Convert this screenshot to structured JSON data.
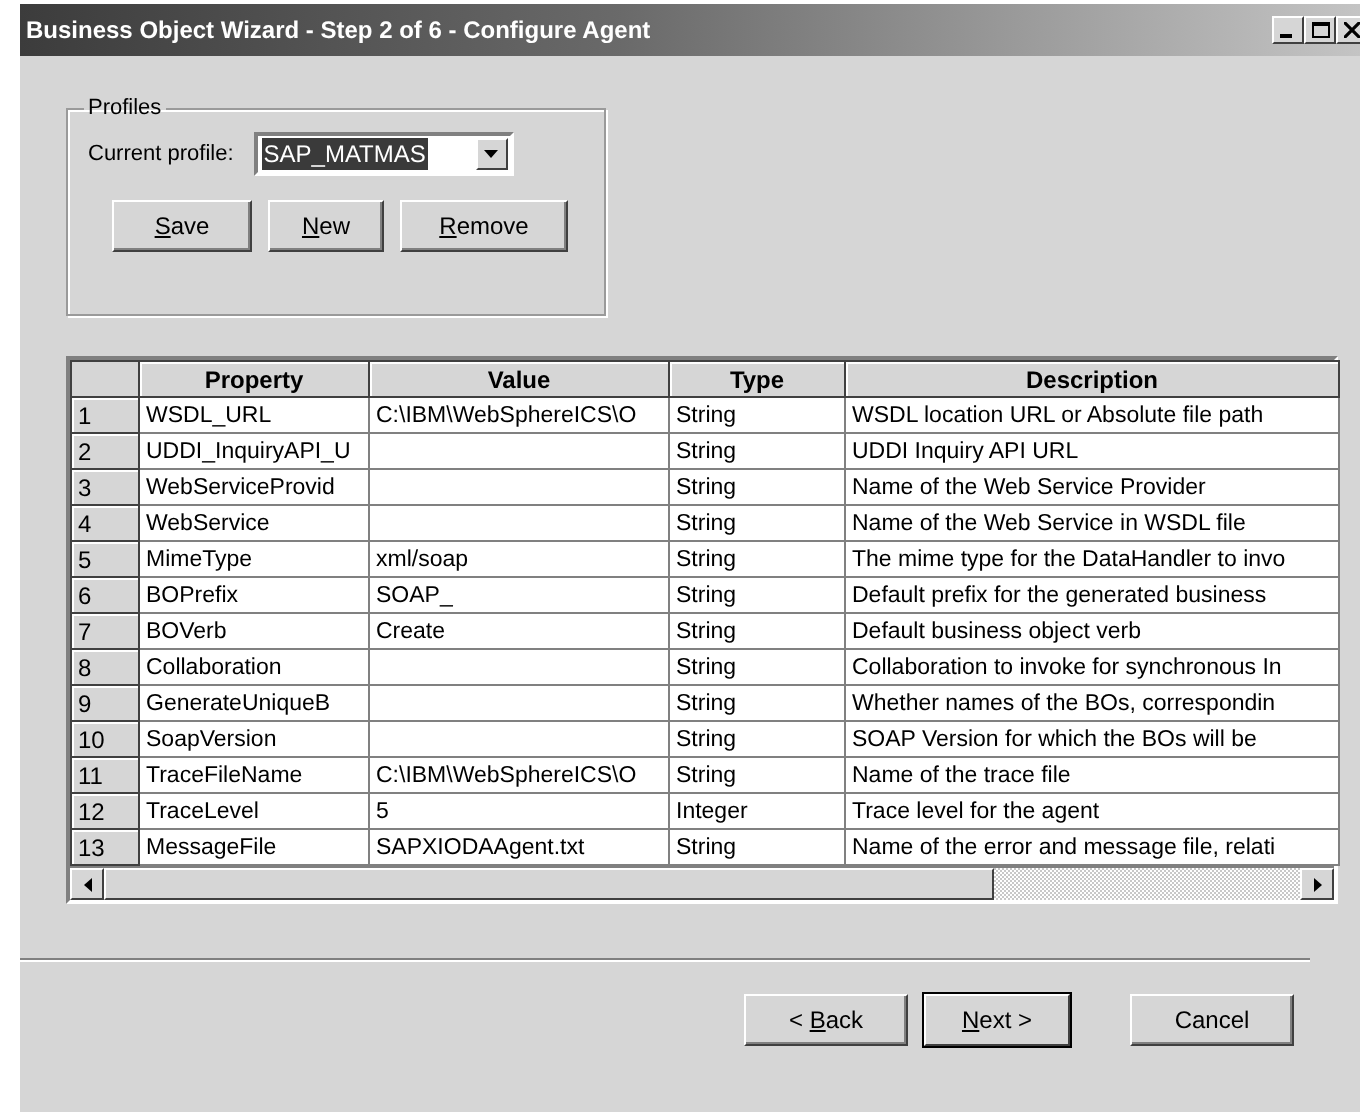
{
  "window": {
    "title": "Business Object Wizard - Step 2 of 6 - Configure Agent"
  },
  "profiles": {
    "legend": "Profiles",
    "label": "Current profile:",
    "value": "SAP_MATMAS",
    "text_selected": true,
    "buttons": [
      {
        "key": "S",
        "post": "ave"
      },
      {
        "key": "N",
        "post": "ew"
      },
      {
        "key": "R",
        "post": "emove"
      }
    ]
  },
  "table": {
    "columns": [
      "Property",
      "Value",
      "Type",
      "Description"
    ],
    "rows": [
      {
        "number": "1",
        "cells": [
          "WSDL_URL",
          "C:\\IBM\\WebSphereICS\\O",
          "String",
          "WSDL location URL or Absolute file path"
        ]
      },
      {
        "number": "2",
        "cells": [
          "UDDI_InquiryAPI_U",
          "",
          "String",
          "UDDI Inquiry API URL"
        ]
      },
      {
        "number": "3",
        "cells": [
          "WebServiceProvid",
          "",
          "String",
          "Name of the Web Service Provider"
        ]
      },
      {
        "number": "4",
        "cells": [
          "WebService",
          "",
          "String",
          "Name of the Web Service in WSDL file"
        ]
      },
      {
        "number": "5",
        "cells": [
          "MimeType",
          "xml/soap",
          "String",
          "The mime type for the DataHandler to invo"
        ]
      },
      {
        "number": "6",
        "cells": [
          "BOPrefix",
          "SOAP_",
          "String",
          "Default prefix for the generated business"
        ]
      },
      {
        "number": "7",
        "cells": [
          "BOVerb",
          "Create",
          "String",
          "Default business object verb"
        ]
      },
      {
        "number": "8",
        "cells": [
          "Collaboration",
          "",
          "String",
          "Collaboration to invoke for synchronous In"
        ]
      },
      {
        "number": "9",
        "cells": [
          "GenerateUniqueB",
          "",
          "String",
          "Whether names of the BOs, correspondin"
        ]
      },
      {
        "number": "10",
        "cells": [
          "SoapVersion",
          "",
          "String",
          "SOAP Version for which the BOs will be"
        ]
      },
      {
        "number": "11",
        "cells": [
          "TraceFileName",
          "C:\\IBM\\WebSphereICS\\O",
          "String",
          "Name of the trace file"
        ]
      },
      {
        "number": "12",
        "cells": [
          "TraceLevel",
          "5",
          "Integer",
          "Trace level for the agent"
        ]
      },
      {
        "number": "13",
        "cells": [
          "MessageFile",
          "SAPXIODAAgent.txt",
          "String",
          "Name of the error and message file, relati"
        ]
      }
    ]
  },
  "buttons": [
    {
      "pre": "< ",
      "key": "B",
      "post": "ack",
      "default": false
    },
    {
      "key": "N",
      "post": "ext >",
      "default": true
    },
    {
      "pre": "Cancel",
      "default": false
    }
  ]
}
